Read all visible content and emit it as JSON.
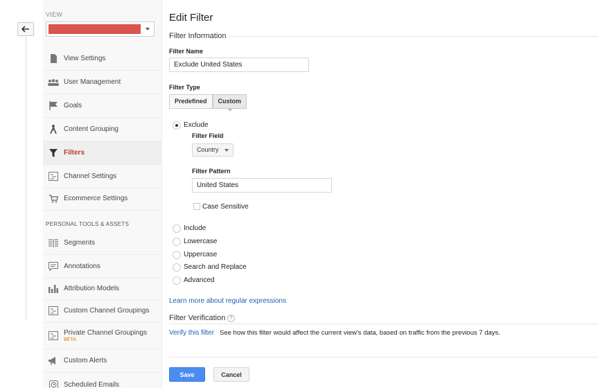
{
  "sidebar": {
    "view_label": "VIEW",
    "admin_items": [
      {
        "label": "View Settings",
        "icon": "document-icon"
      },
      {
        "label": "User Management",
        "icon": "users-icon"
      },
      {
        "label": "Goals",
        "icon": "flag-icon"
      },
      {
        "label": "Content Grouping",
        "icon": "person-icon"
      },
      {
        "label": "Filters",
        "icon": "filter-icon",
        "active": true
      },
      {
        "label": "Channel Settings",
        "icon": "channel-icon"
      },
      {
        "label": "Ecommerce Settings",
        "icon": "cart-icon"
      }
    ],
    "personal_heading": "PERSONAL TOOLS & ASSETS",
    "personal_items": [
      {
        "label": "Segments",
        "icon": "segments-icon"
      },
      {
        "label": "Annotations",
        "icon": "comment-icon"
      },
      {
        "label": "Attribution Models",
        "icon": "bar-chart-icon"
      },
      {
        "label": "Custom Channel Groupings",
        "icon": "channel-icon"
      },
      {
        "label": "Private Channel Groupings",
        "icon": "channel-icon",
        "badge": "BETA"
      },
      {
        "label": "Custom Alerts",
        "icon": "megaphone-icon"
      },
      {
        "label": "Scheduled Emails",
        "icon": "clock-icon"
      }
    ]
  },
  "main": {
    "title": "Edit Filter",
    "filter_info_title": "Filter Information",
    "filter_name_label": "Filter Name",
    "filter_name_value": "Exclude United States",
    "filter_type_label": "Filter Type",
    "type_tabs": [
      "Predefined",
      "Custom"
    ],
    "selected_type": "Custom",
    "options": {
      "exclude": "Exclude",
      "include": "Include",
      "lowercase": "Lowercase",
      "uppercase": "Uppercase",
      "search_replace": "Search and Replace",
      "advanced": "Advanced"
    },
    "selected_option": "Exclude",
    "filter_field_label": "Filter Field",
    "filter_field_value": "Country",
    "filter_pattern_label": "Filter Pattern",
    "filter_pattern_value": "United States",
    "case_sensitive_label": "Case Sensitive",
    "case_sensitive_checked": false,
    "learn_more_link": "Learn more about regular expressions",
    "verification_title": "Filter Verification",
    "verify_link": "Verify this filter",
    "verify_description": "See how this filter would affect the current view's data, based on traffic from the previous 7 days.",
    "save_label": "Save",
    "cancel_label": "Cancel"
  },
  "colors": {
    "active_nav": "#c0392b",
    "link": "#1a5fb4",
    "save_button": "#4a8df0",
    "view_selector_fill": "#d9534f",
    "beta_badge": "#e07a00"
  }
}
